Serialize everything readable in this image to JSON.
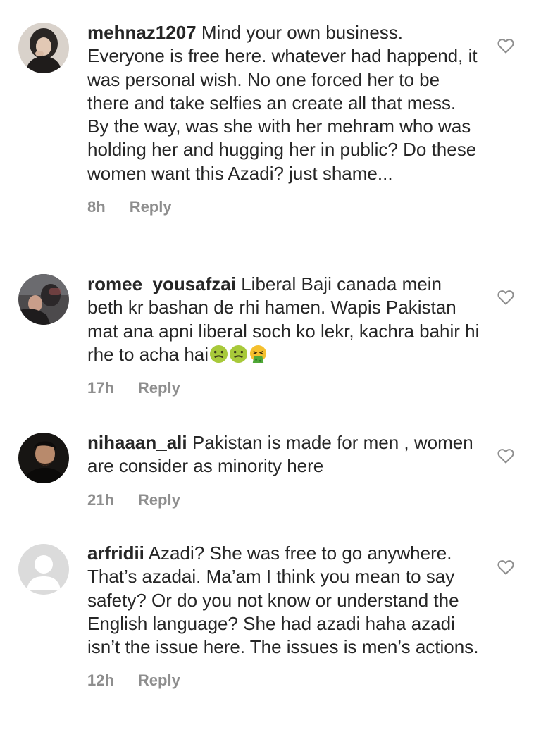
{
  "comments": [
    {
      "username": "mehnaz1207",
      "text": "Mind your own business. Everyone is free here. whatever had happend, it was personal wish. No one forced her to be there and take selfies an create all that mess. By the way, was she with her mehram who was holding her and hugging her in public? Do these women want this Azadi? just shame...",
      "time": "8h",
      "reply": "Reply"
    },
    {
      "username": "romee_yousafzai",
      "text": "Liberal Baji canada mein beth kr bashan de rhi hamen. Wapis Pakistan mat ana apni liberal soch ko lekr, kachra bahir hi rhe to acha hai",
      "emojis": [
        "nauseated-face",
        "nauseated-face",
        "vomiting-face"
      ],
      "time": "17h",
      "reply": "Reply"
    },
    {
      "username": "nihaaan_ali",
      "text": "Pakistan is made for men , women are consider as minority here",
      "time": "21h",
      "reply": "Reply"
    },
    {
      "username": "arfridii",
      "text": "Azadi? She was free to go anywhere. That’s azadai. Ma’am I think you mean to say safety? Or do you not know or understand the English language? She had azadi haha azadi isn’t the issue here. The issues is men’s actions.",
      "time": "12h",
      "reply": "Reply"
    }
  ],
  "icons": {
    "like": "heart-outline-icon"
  },
  "colors": {
    "text": "#262626",
    "meta": "#8e8e8e",
    "heart": "#8e8e8e",
    "default_avatar_bg": "#dbdbdb"
  }
}
